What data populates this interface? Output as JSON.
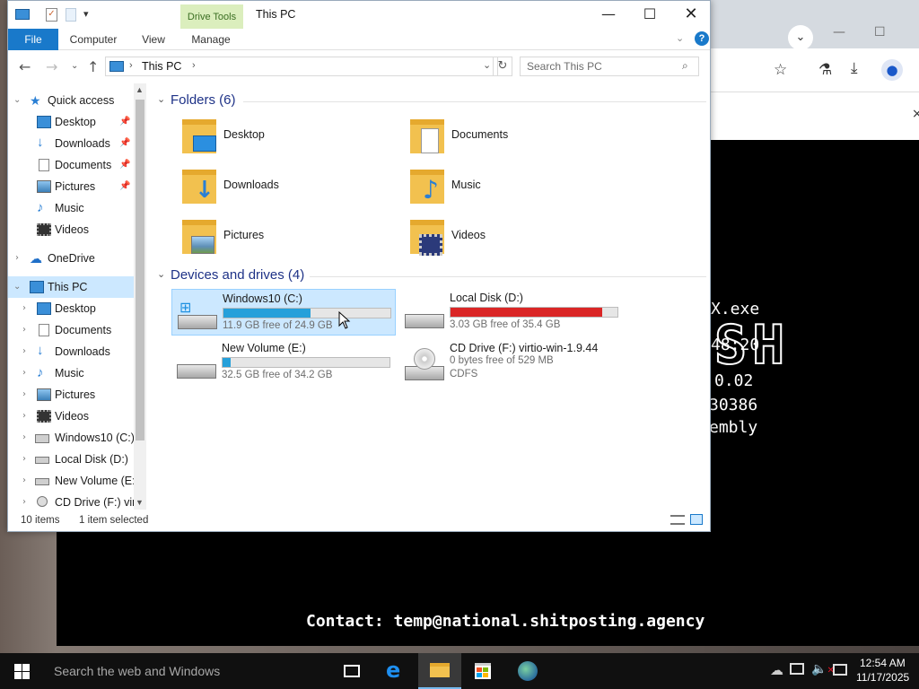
{
  "explorer": {
    "title": "This PC",
    "context_tab": "Drive Tools",
    "ribbon_tabs": [
      "File",
      "Computer",
      "View",
      "Manage"
    ],
    "address": "This PC",
    "search_placeholder": "Search This PC",
    "nav": {
      "quick_access": "Quick access",
      "quick_items": [
        "Desktop",
        "Downloads",
        "Documents",
        "Pictures",
        "Music",
        "Videos"
      ],
      "onedrive": "OneDrive",
      "this_pc": "This PC",
      "pc_items": [
        "Desktop",
        "Documents",
        "Downloads",
        "Music",
        "Pictures",
        "Videos",
        "Windows10 (C:)",
        "Local Disk (D:)",
        "New Volume (E:)",
        "CD Drive (F:) virt"
      ]
    },
    "folders_header": "Folders (6)",
    "folders": [
      "Desktop",
      "Documents",
      "Downloads",
      "Music",
      "Pictures",
      "Videos"
    ],
    "drives_header": "Devices and drives (4)",
    "drives": [
      {
        "name": "Windows10 (C:)",
        "free": "11.9 GB free of 24.9 GB",
        "used_fraction": 0.52,
        "bar_color": "#26a0da"
      },
      {
        "name": "Local Disk (D:)",
        "free": "3.03 GB free of 35.4 GB",
        "used_fraction": 0.91,
        "bar_color": "#da2626"
      },
      {
        "name": "New Volume (E:)",
        "free": "32.5 GB free of 34.2 GB",
        "used_fraction": 0.05,
        "bar_color": "#26a0da"
      },
      {
        "name": "CD Drive (F:) virtio-win-1.9.44",
        "free": "0 bytes free of 529 MB",
        "fs": "CDFS"
      }
    ],
    "status_items": "10 items",
    "status_selected": "1 item selected"
  },
  "console": {
    "lines": [
      "X.exe",
      "48:20",
      "0.02",
      "30386",
      "embly"
    ],
    "contact": "Contact: temp@national.shitposting.agency",
    "ascii": "SH"
  },
  "taskbar": {
    "search_placeholder": "Search the web and Windows",
    "time": "12:54 AM",
    "date": "11/17/2025"
  },
  "colors": {
    "accent": "#1979ca",
    "selection": "#cce8ff",
    "taskbar": "#101010"
  }
}
